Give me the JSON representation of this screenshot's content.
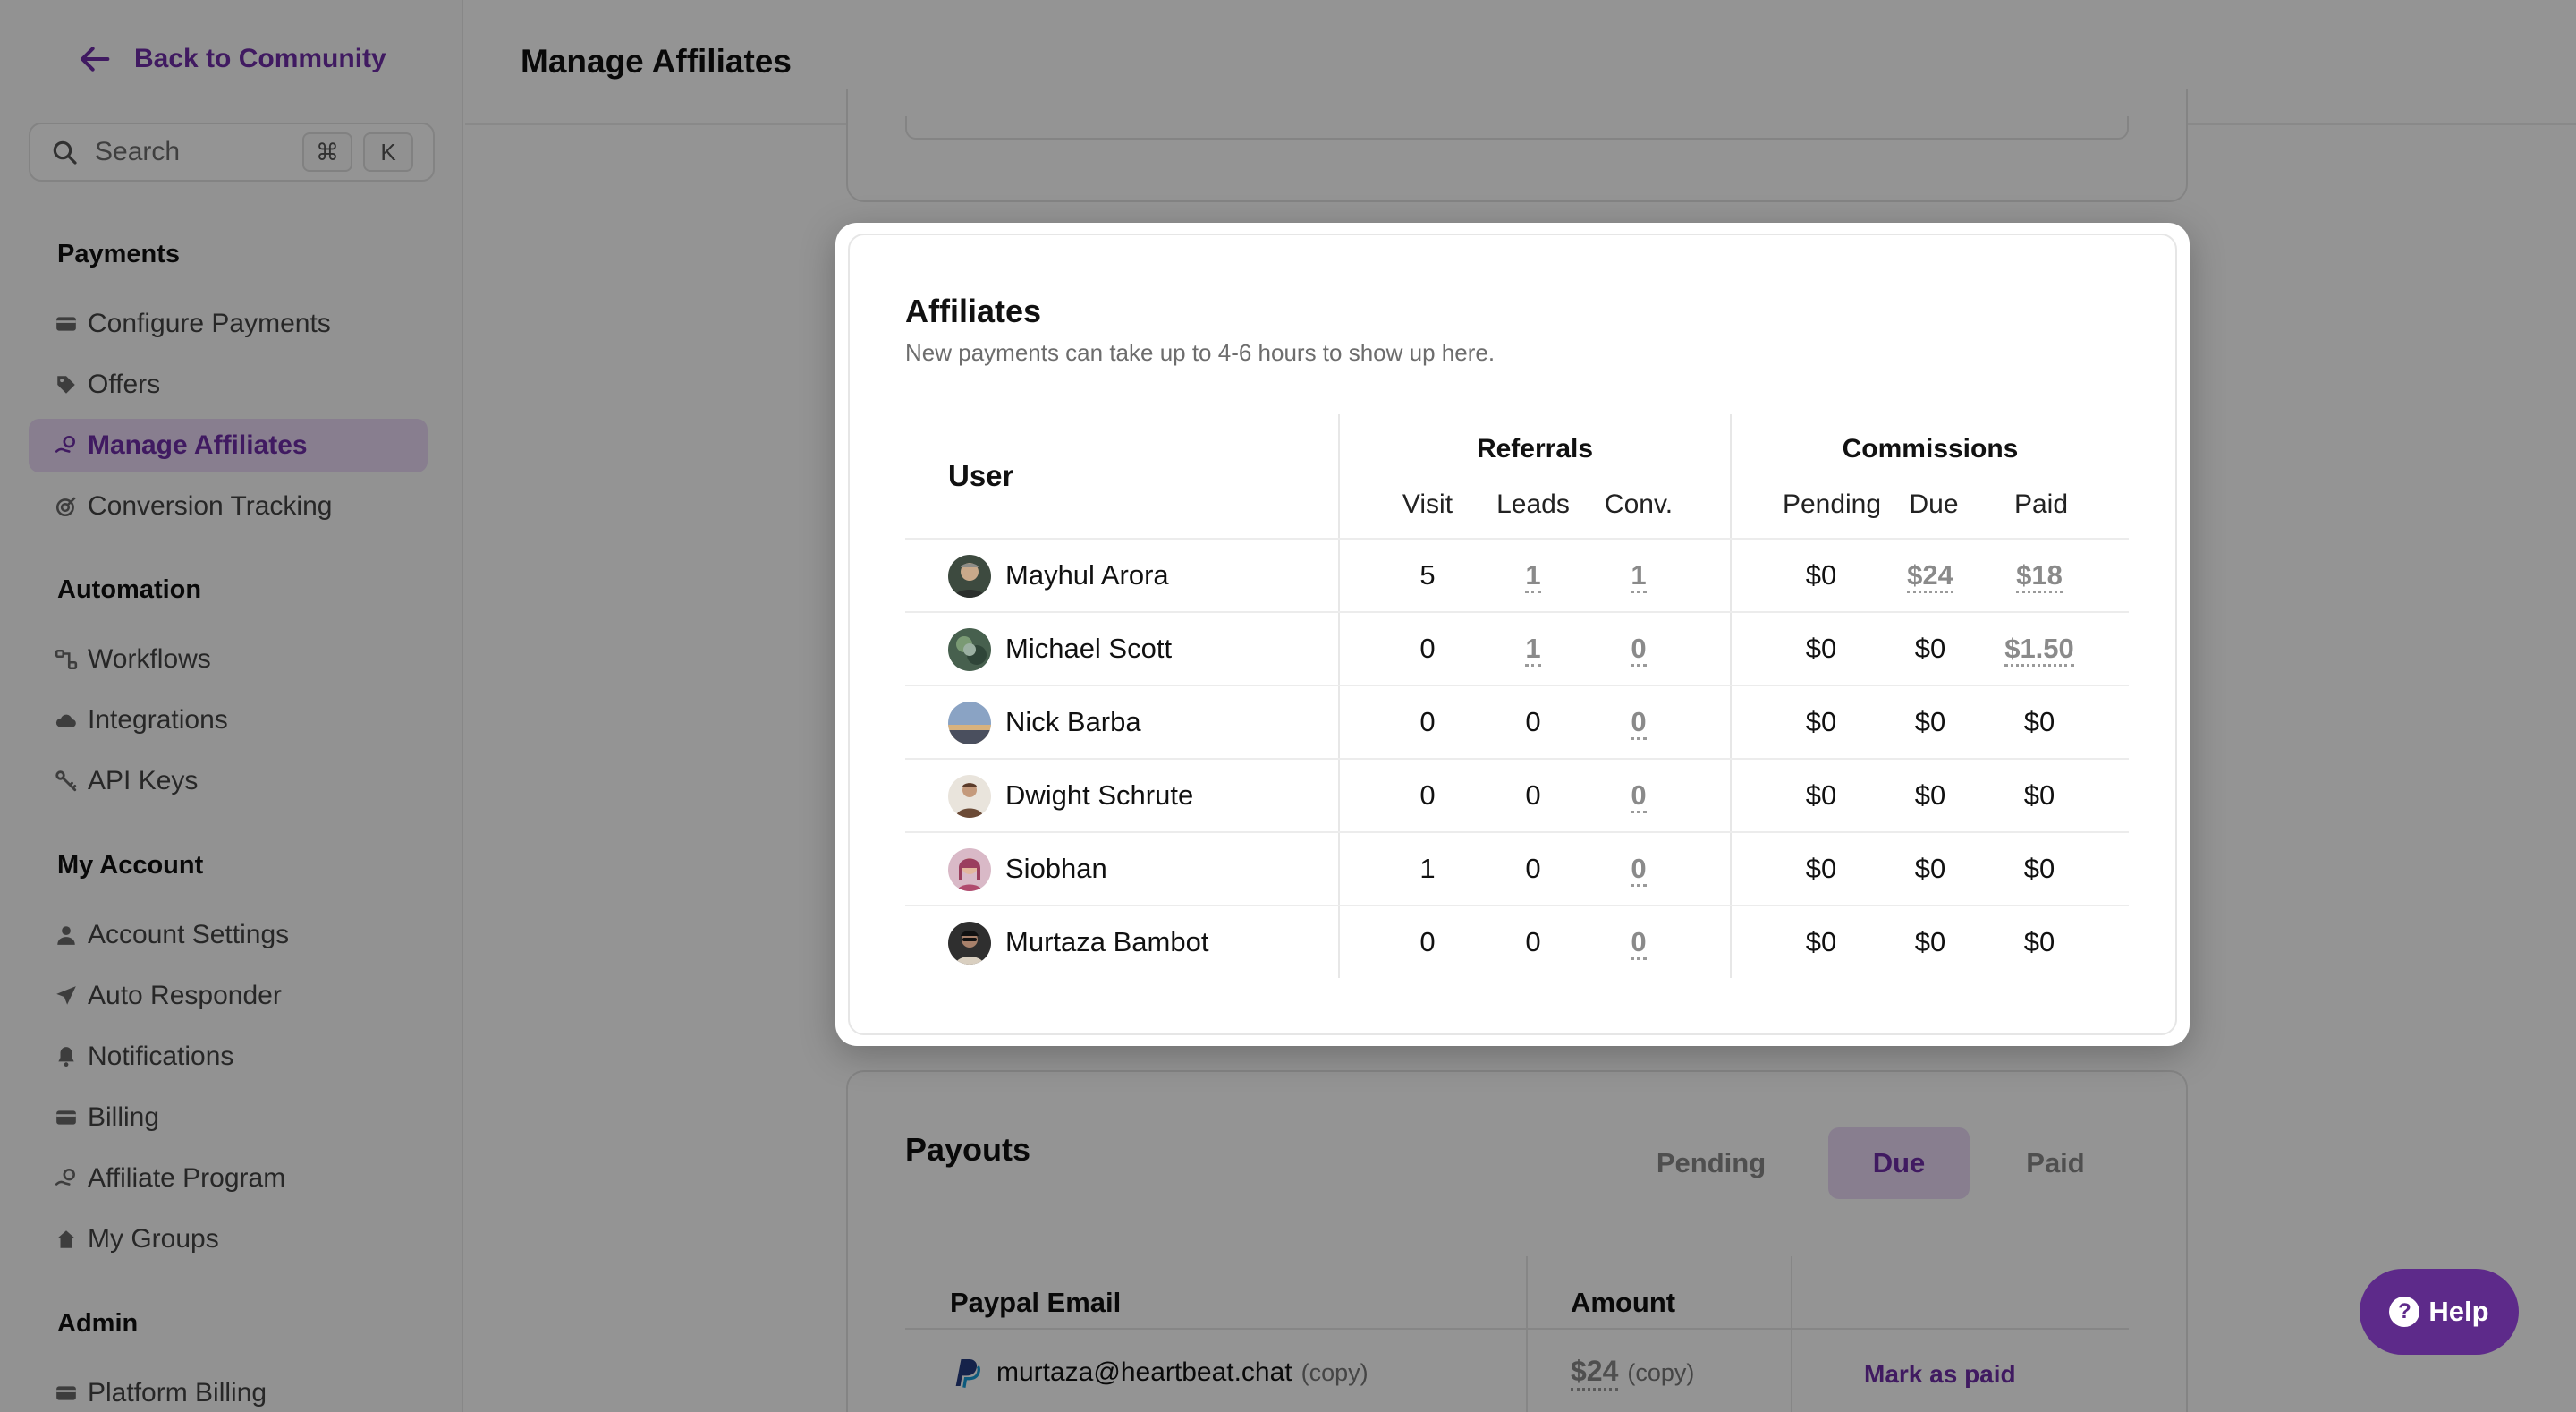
{
  "sidebar": {
    "back_label": "Back to Community",
    "search_placeholder": "Search",
    "shortcut_keys": [
      "⌘",
      "K"
    ],
    "sections": [
      {
        "title": "Payments",
        "items": [
          {
            "label": "Configure Payments",
            "icon": "card-icon"
          },
          {
            "label": "Offers",
            "icon": "tag-icon"
          },
          {
            "label": "Manage Affiliates",
            "icon": "hand-coin-icon",
            "active": true
          },
          {
            "label": "Conversion Tracking",
            "icon": "target-icon"
          }
        ]
      },
      {
        "title": "Automation",
        "items": [
          {
            "label": "Workflows",
            "icon": "workflow-icon"
          },
          {
            "label": "Integrations",
            "icon": "cloud-icon"
          },
          {
            "label": "API Keys",
            "icon": "key-icon"
          }
        ]
      },
      {
        "title": "My Account",
        "items": [
          {
            "label": "Account Settings",
            "icon": "user-icon"
          },
          {
            "label": "Auto Responder",
            "icon": "paper-plane-icon"
          },
          {
            "label": "Notifications",
            "icon": "bell-icon"
          },
          {
            "label": "Billing",
            "icon": "card-icon"
          },
          {
            "label": "Affiliate Program",
            "icon": "hand-coin-icon"
          },
          {
            "label": "My Groups",
            "icon": "house-icon"
          }
        ]
      },
      {
        "title": "Admin",
        "items": [
          {
            "label": "Platform Billing",
            "icon": "card-icon"
          }
        ]
      }
    ]
  },
  "header": {
    "title": "Manage Affiliates"
  },
  "modal": {
    "title": "Affiliates",
    "subtitle": "New payments can take up to 4-6 hours to show up here.",
    "columns": {
      "user": "User",
      "referrals": "Referrals",
      "commissions": "Commissions",
      "visit": "Visit",
      "leads": "Leads",
      "conv": "Conv.",
      "pending": "Pending",
      "due": "Due",
      "paid": "Paid"
    },
    "rows": [
      {
        "name": "Mayhul Arora",
        "visit": "5",
        "leads": "1",
        "conv": "1",
        "pending": "$0",
        "due": "$24",
        "paid": "$18"
      },
      {
        "name": "Michael Scott",
        "visit": "0",
        "leads": "1",
        "conv": "0",
        "pending": "$0",
        "due": "$0",
        "paid": "$1.50"
      },
      {
        "name": "Nick Barba",
        "visit": "0",
        "leads": "0",
        "conv": "0",
        "pending": "$0",
        "due": "$0",
        "paid": "$0"
      },
      {
        "name": "Dwight Schrute",
        "visit": "0",
        "leads": "0",
        "conv": "0",
        "pending": "$0",
        "due": "$0",
        "paid": "$0"
      },
      {
        "name": "Siobhan",
        "visit": "1",
        "leads": "0",
        "conv": "0",
        "pending": "$0",
        "due": "$0",
        "paid": "$0"
      },
      {
        "name": "Murtaza Bambot",
        "visit": "0",
        "leads": "0",
        "conv": "0",
        "pending": "$0",
        "due": "$0",
        "paid": "$0"
      }
    ]
  },
  "payouts": {
    "title": "Payouts",
    "tabs": [
      "Pending",
      "Due",
      "Paid"
    ],
    "active_tab": "Due",
    "col_email": "Paypal Email",
    "col_amount": "Amount",
    "row": {
      "email": "murtaza@heartbeat.chat",
      "copy": "(copy)",
      "amount": "$24",
      "amount_copy": "(copy)",
      "action": "Mark as paid"
    }
  },
  "help": {
    "label": "Help"
  },
  "colors": {
    "accent": "#6f2ea8",
    "accent_bg": "#ead9f7",
    "help_bg": "#5d2a8a"
  }
}
